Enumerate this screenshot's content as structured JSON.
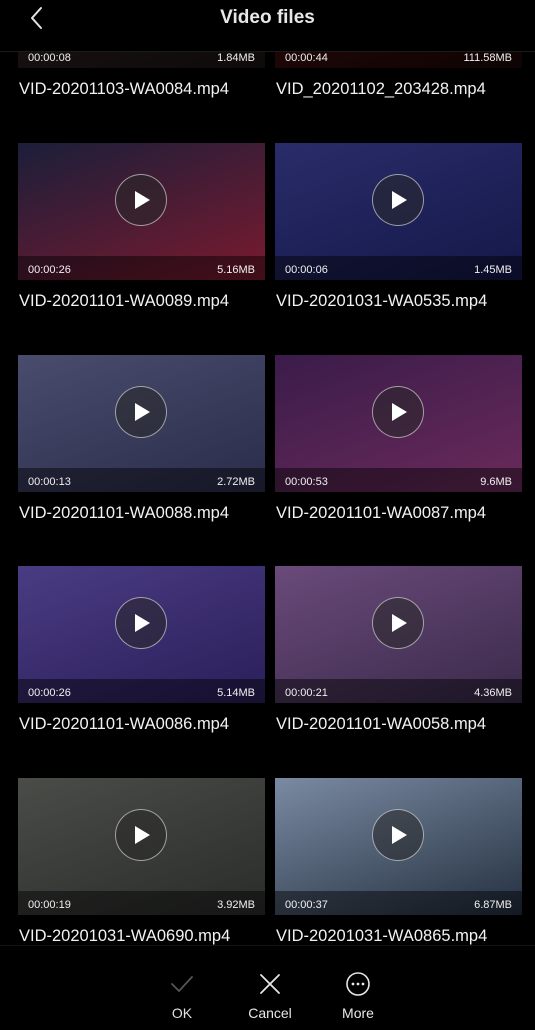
{
  "header": {
    "title": "Video files"
  },
  "videos": [
    {
      "name": "VID-20201103-WA0084.mp4",
      "duration": "00:00:08",
      "size": "1.84MB",
      "thumb": [
        "#3a2a2a",
        "#1c1414"
      ]
    },
    {
      "name": "VID_20201102_203428.mp4",
      "duration": "00:00:44",
      "size": "111.58MB",
      "thumb": [
        "#5a1010",
        "#1a0808"
      ]
    },
    {
      "name": "VID-20201101-WA0089.mp4",
      "duration": "00:00:26",
      "size": "5.16MB",
      "thumb": [
        "#1b1e3a",
        "#7a1a2e"
      ]
    },
    {
      "name": "VID-20201031-WA0535.mp4",
      "duration": "00:00:06",
      "size": "1.45MB",
      "thumb": [
        "#2a2c6a",
        "#141848"
      ]
    },
    {
      "name": "VID-20201101-WA0088.mp4",
      "duration": "00:00:13",
      "size": "2.72MB",
      "thumb": [
        "#4a4c6e",
        "#2a2c4a"
      ]
    },
    {
      "name": "VID-20201101-WA0087.mp4",
      "duration": "00:00:53",
      "size": "9.6MB",
      "thumb": [
        "#3a1c4a",
        "#6a2a5a"
      ]
    },
    {
      "name": "VID-20201101-WA0086.mp4",
      "duration": "00:00:26",
      "size": "5.14MB",
      "thumb": [
        "#4a3c82",
        "#2a1e5a"
      ]
    },
    {
      "name": "VID-20201101-WA0058.mp4",
      "duration": "00:00:21",
      "size": "4.36MB",
      "thumb": [
        "#6a4a7a",
        "#3a2a4a"
      ]
    },
    {
      "name": "VID-20201031-WA0690.mp4",
      "duration": "00:00:19",
      "size": "3.92MB",
      "thumb": [
        "#4a4c48",
        "#2a2c2a"
      ]
    },
    {
      "name": "VID-20201031-WA0865.mp4",
      "duration": "00:00:37",
      "size": "6.87MB",
      "thumb": [
        "#7a8aa2",
        "#243040"
      ]
    }
  ],
  "actions": {
    "ok": "OK",
    "cancel": "Cancel",
    "more": "More"
  },
  "icons": {
    "back": "chevron-left-icon",
    "play": "play-icon",
    "ok": "check-icon",
    "cancel": "close-icon",
    "more": "more-icon"
  }
}
